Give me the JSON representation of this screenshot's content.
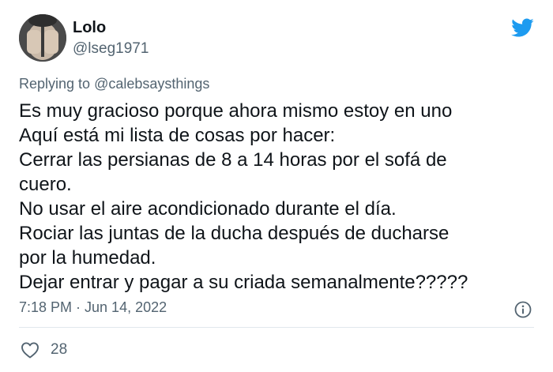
{
  "tweet": {
    "display_name": "Lolo",
    "handle": "@lseg1971",
    "replying_prefix": "Replying to",
    "replying_to": "@calebsaysthings",
    "lines": [
      "Es muy gracioso porque ahora mismo estoy en uno",
      "Aquí está mi lista de cosas por hacer:",
      "Cerrar las persianas de 8 a 14 horas por el sofá de",
      "cuero.",
      "No usar el aire acondicionado durante el día.",
      "Rociar las juntas de la ducha después de ducharse",
      "por la humedad.",
      "Dejar entrar y pagar a su criada semanalmente?????"
    ],
    "timestamp": "7:18 PM · Jun 14, 2022",
    "like_count": "28"
  },
  "icons": {
    "brand": "twitter-bird-icon",
    "info": "info-icon",
    "like": "heart-icon"
  },
  "colors": {
    "twitter_blue": "#1d9bf0",
    "secondary_text": "#536471",
    "primary_text": "#0f1419"
  }
}
